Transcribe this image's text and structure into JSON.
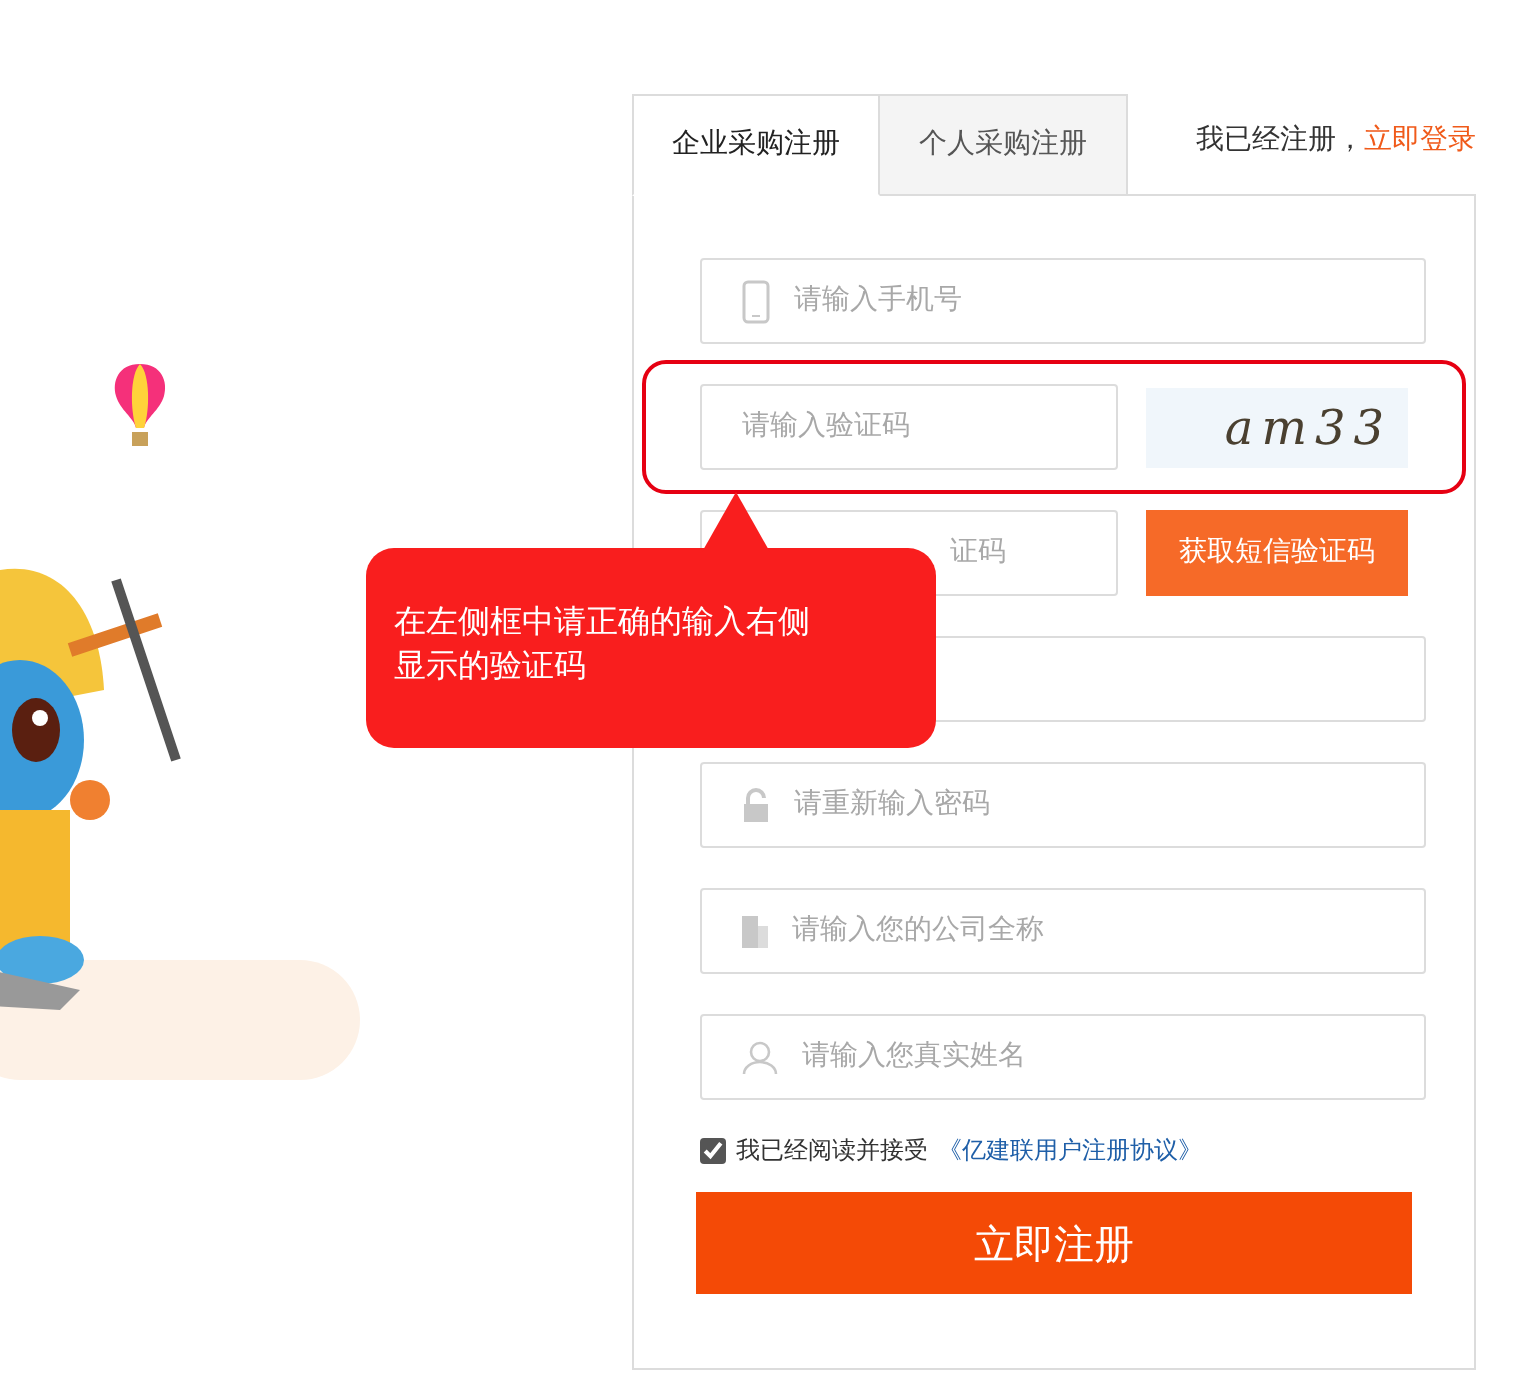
{
  "tabs": [
    {
      "label": "企业采购注册",
      "selected": true
    },
    {
      "label": "个人采购注册",
      "selected": false
    }
  ],
  "login_prompt": {
    "text": "我已经注册，",
    "link": "立即登录"
  },
  "fields": [
    {
      "kind": "phone",
      "placeholder": "请输入手机号"
    },
    {
      "kind": "captcha",
      "placeholder": "请输入验证码",
      "captcha_text": "am33",
      "highlighted": true
    },
    {
      "kind": "sms",
      "placeholder": "证码",
      "button": "获取短信验证码"
    },
    {
      "kind": "password"
    },
    {
      "kind": "confirm",
      "placeholder": "请重新输入密码"
    },
    {
      "kind": "company",
      "placeholder": "请输入您的公司全称"
    },
    {
      "kind": "name",
      "placeholder": "请输入您真实姓名"
    }
  ],
  "agreement": {
    "checked": true,
    "text": "我已经阅读并接受",
    "link": "《亿建联用户注册协议》"
  },
  "submit": "立即注册",
  "tooltip": {
    "text": "在左侧框中请正确的输入右侧显示的验证码"
  }
}
